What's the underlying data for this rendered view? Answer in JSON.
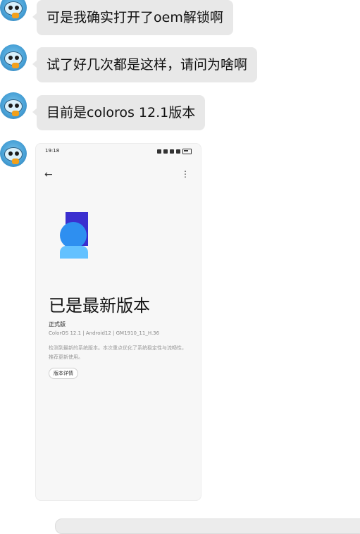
{
  "messages": [
    {
      "text": "可是我确实打开了oem解锁啊"
    },
    {
      "text": "试了好几次都是这样，请问为啥啊"
    },
    {
      "text": "目前是coloros  12.1版本"
    }
  ],
  "screenshot": {
    "time": "19:18",
    "back_icon": "back-arrow-icon",
    "more_icon": "more-vertical-icon",
    "title": "已是最新版本",
    "subtitle": "正式版",
    "versions": "ColorOS 12.1   |   Android12   |   GM1910_11_H.36",
    "description": "检测到最新的系统版本。本次重点优化了系统稳定性与流畅性，推荐更新使用。",
    "details_button": "版本详情"
  },
  "colors": {
    "bubble_bg": "#e8e8e8",
    "logo_indigo": "#3b2fcf",
    "logo_blue": "#2e8ff0",
    "logo_light": "#63c1ff"
  }
}
